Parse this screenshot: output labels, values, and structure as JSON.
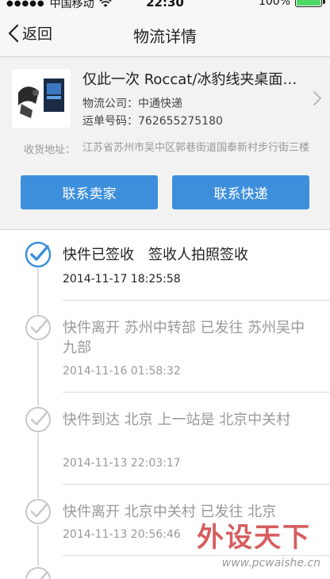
{
  "status_bar": {
    "carrier": "中国移动",
    "time": "22:30",
    "battery": "100%",
    "battery_level": 1.0,
    "signal_icon": "signal-dots-icon",
    "wifi_icon": "wifi-icon",
    "battery_icon": "battery-icon"
  },
  "nav": {
    "back_label": "返回",
    "title": "物流详情"
  },
  "order": {
    "product_title": "仅此一次 Roccat/冰豹线夹桌面…",
    "company_label": "物流公司：",
    "company_value": "中通快递",
    "waybill_label": "运单号码：",
    "waybill_value": "762655275180",
    "address_label": "收货地址：",
    "address_value": "江苏省苏州市吴中区郭巷街道国泰新村步行街三楼"
  },
  "buttons": {
    "contact_seller": "联系卖家",
    "contact_express": "联系快递"
  },
  "timeline": [
    {
      "text": "快件已签收　签收人拍照签收",
      "time": "2014-11-17 18:25:58",
      "current": true
    },
    {
      "text": "快件离开 苏州中转部 已发往 苏州吴中九部",
      "time": "2014-11-16 01:58:32",
      "current": false
    },
    {
      "text": "快件到达 北京 上一站是 北京中关村",
      "time": "2014-11-13 22:03:17",
      "current": false
    },
    {
      "text": "快件离开 北京中关村 已发往 北京",
      "time": "2014-11-13 20:56:46",
      "current": false
    }
  ],
  "watermark": {
    "logo": "外设天下",
    "url": "www.pcwaishe.cn"
  },
  "colors": {
    "accent_blue": "#3d8fdc",
    "check_current": "#3d8fdc",
    "check_past": "#c8c8c8"
  }
}
